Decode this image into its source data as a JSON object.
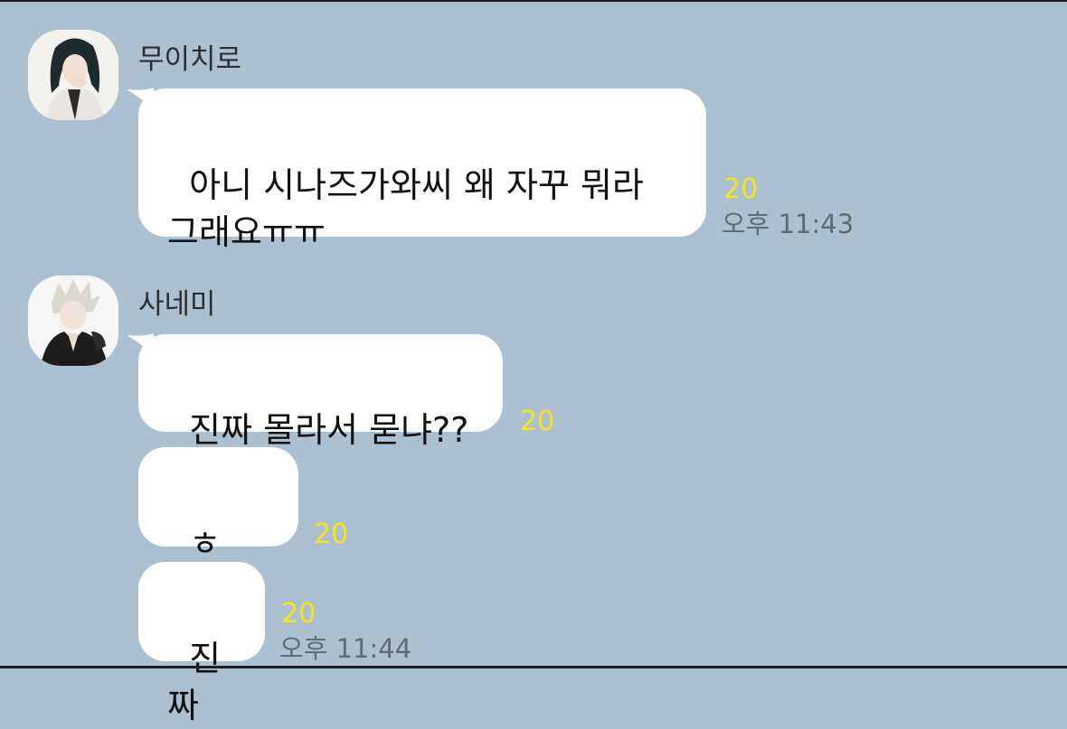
{
  "chat": {
    "messages": [
      {
        "sender": "무이치로",
        "text": "아니 시나즈가와씨 왜 자꾸 뭐라\n그래요ㅠㅠ",
        "unread": "20",
        "time": "오후 11:43"
      },
      {
        "sender": "사네미",
        "text": "진짜 몰라서 묻냐??",
        "unread": "20"
      },
      {
        "text": "ㅎㅏ...",
        "unread": "20"
      },
      {
        "text": "진짜",
        "unread": "20",
        "time": "오후 11:44"
      }
    ]
  },
  "colors": {
    "background": "#abc1d1",
    "bubble": "#ffffff",
    "unread_count": "#f6e21a",
    "timestamp": "#5e6b76"
  },
  "icons": {
    "avatar_1": "profile-photo-muichiro",
    "avatar_2": "profile-photo-sanemi"
  }
}
